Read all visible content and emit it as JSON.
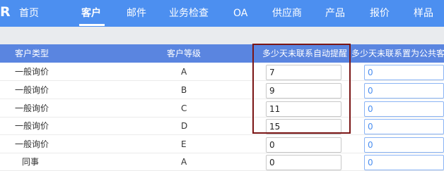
{
  "logo": "R",
  "nav": {
    "items": [
      {
        "label": "首页"
      },
      {
        "label": "客户"
      },
      {
        "label": "邮件"
      },
      {
        "label": "业务检查"
      },
      {
        "label": "OA"
      },
      {
        "label": "供应商"
      },
      {
        "label": "产品"
      },
      {
        "label": "报价"
      },
      {
        "label": "样品"
      }
    ],
    "active_index": 1
  },
  "table": {
    "headers": {
      "customer_type": "客户类型",
      "customer_level": "客户等级",
      "remind_days": "多少天未联系自动提醒",
      "public_days": "多少天未联系置为公共客户"
    },
    "rows": [
      {
        "type": "一般询价",
        "level": "A",
        "remind": "7",
        "public": "0"
      },
      {
        "type": "一般询价",
        "level": "B",
        "remind": "9",
        "public": "0"
      },
      {
        "type": "一般询价",
        "level": "C",
        "remind": "11",
        "public": "0"
      },
      {
        "type": "一般询价",
        "level": "D",
        "remind": "15",
        "public": "0"
      },
      {
        "type": "一般询价",
        "level": "E",
        "remind": "0",
        "public": "0"
      },
      {
        "type": "同事",
        "level": "A",
        "remind": "0",
        "public": "0"
      }
    ]
  },
  "colors": {
    "nav_bg": "#4c8ff0",
    "header_bg": "#5a85e0",
    "highlight_border": "#7a1515"
  }
}
